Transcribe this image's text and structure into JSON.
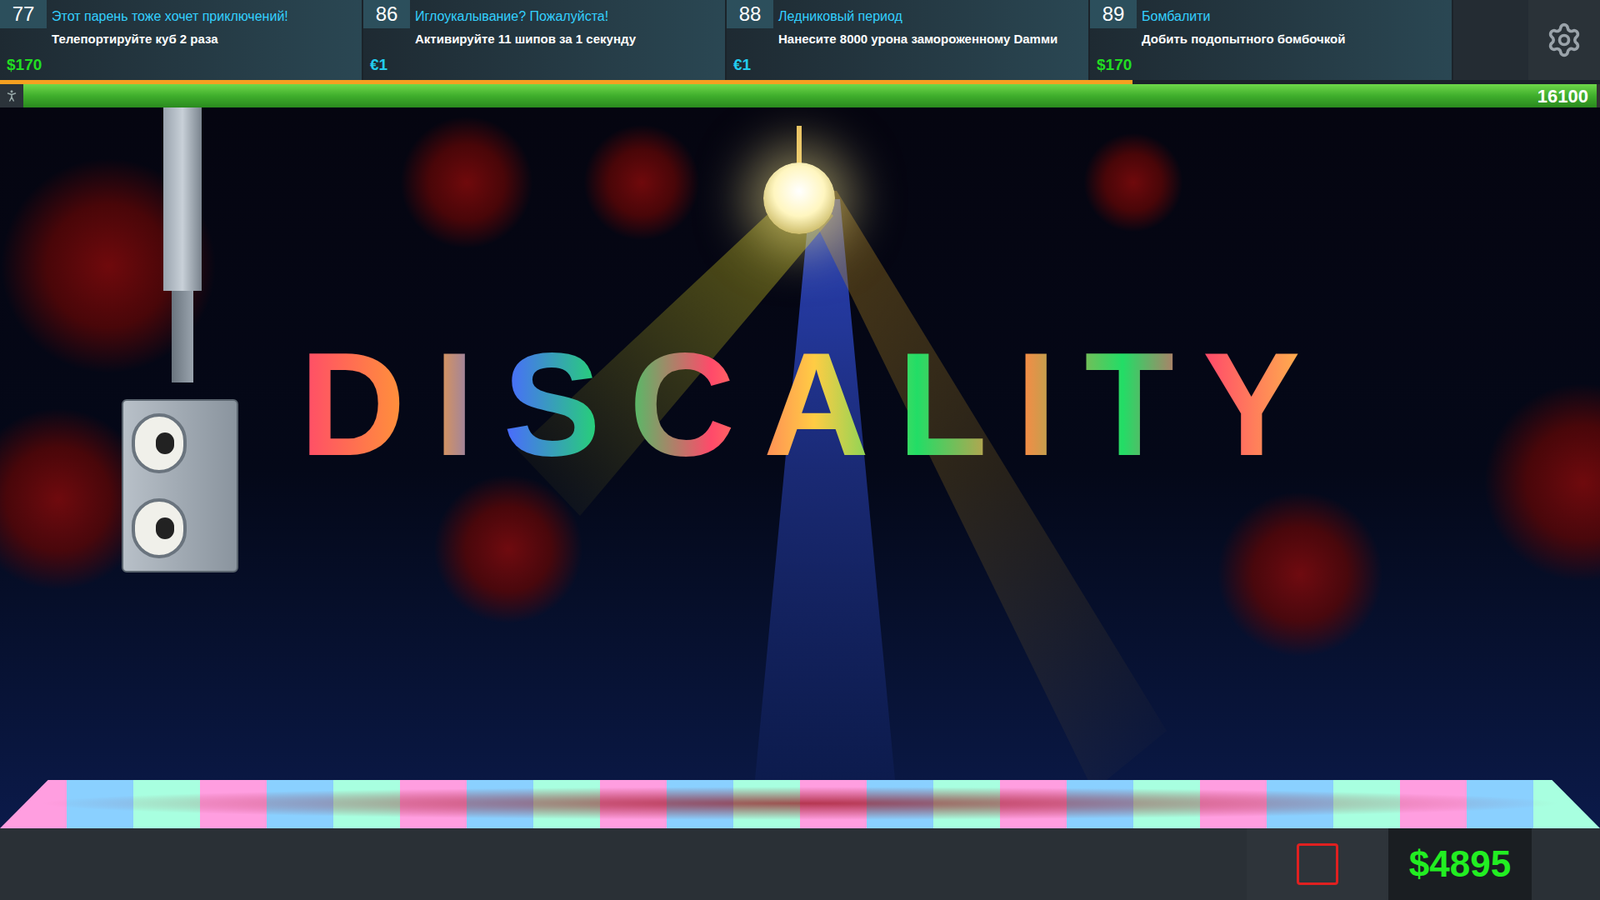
{
  "challenges": [
    {
      "number": "77",
      "title": "Этот парень тоже хочет приключений!",
      "description": "Телепортируйте куб 2 раза",
      "reward": "$170",
      "color": "#22dd22"
    },
    {
      "number": "86",
      "title": "Иглоукалывание? Пожалуйста!",
      "description": "Активируйте 11 шипов за 1 секунду",
      "reward": "€1",
      "color": "#22ccee"
    },
    {
      "number": "88",
      "title": "Ледниковый период",
      "description": "Нанесите 8000 урона замороженному Damми",
      "reward": "€1",
      "color": "#22ccee"
    },
    {
      "number": "89",
      "title": "Бомбалити",
      "description": "Добить подопытного бомбочкой",
      "reward": "$170",
      "color": "#22dd22"
    }
  ],
  "challenge_progress": {
    "level": 0.708
  },
  "health": {
    "level": 0.998,
    "reading": "16100"
  },
  "scene": {
    "title": "DISCALITY"
  },
  "stop_button": {
    "active": false
  },
  "money": "$4895"
}
